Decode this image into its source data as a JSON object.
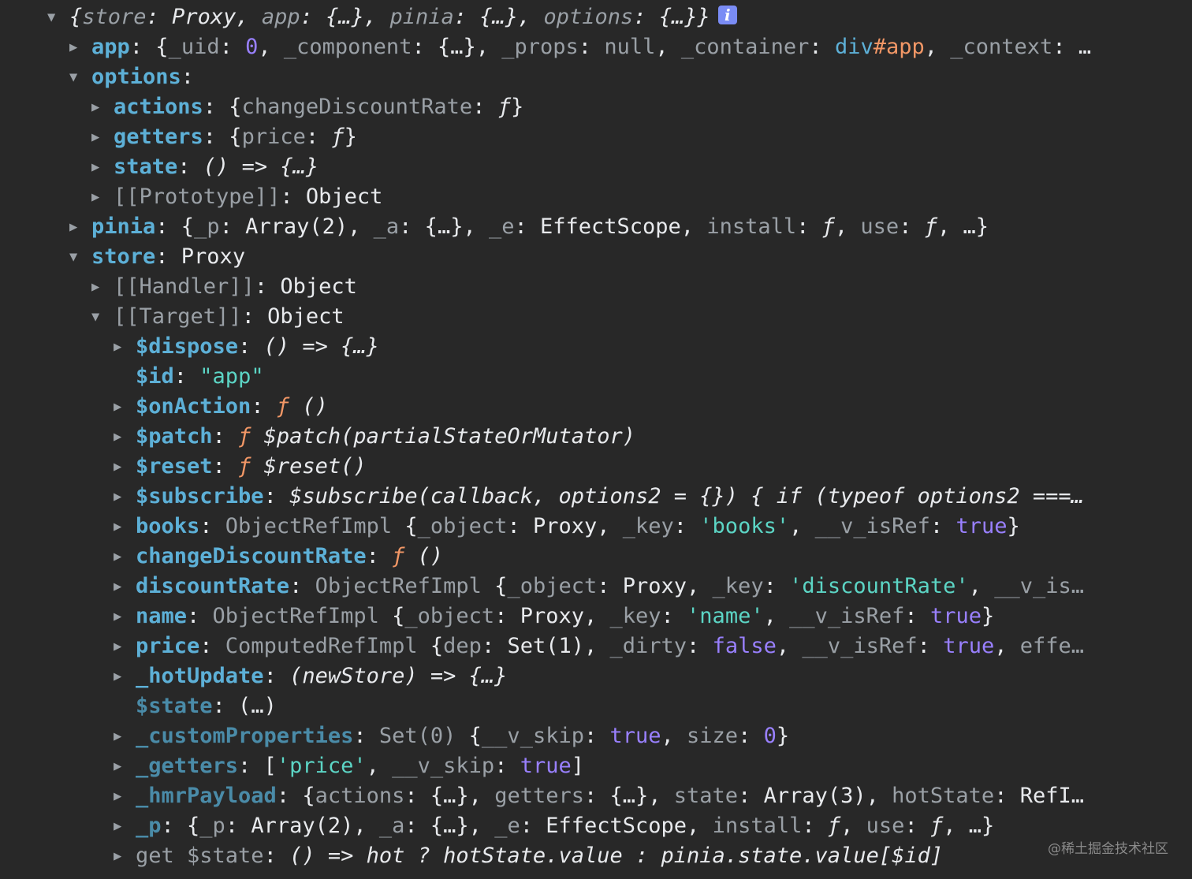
{
  "rows": [
    {
      "indent": 0,
      "toggle": "expanded",
      "segs": [
        {
          "c": "p it",
          "t": "{"
        },
        {
          "c": "gry it",
          "t": "store"
        },
        {
          "c": "p it",
          "t": ": Proxy, "
        },
        {
          "c": "gry it",
          "t": "app"
        },
        {
          "c": "p it",
          "t": ": {…}, "
        },
        {
          "c": "gry it",
          "t": "pinia"
        },
        {
          "c": "p it",
          "t": ": {…}, "
        },
        {
          "c": "gry it",
          "t": "options"
        },
        {
          "c": "p it",
          "t": ": {…}}"
        }
      ],
      "badge": "i"
    },
    {
      "indent": 1,
      "toggle": "collapsed",
      "segs": [
        {
          "c": "k-own",
          "t": "app"
        },
        {
          "c": "p",
          "t": ": {"
        },
        {
          "c": "gry",
          "t": "_uid"
        },
        {
          "c": "p",
          "t": ": "
        },
        {
          "c": "num",
          "t": "0"
        },
        {
          "c": "p",
          "t": ", "
        },
        {
          "c": "gry",
          "t": "_component"
        },
        {
          "c": "p",
          "t": ": {…}, "
        },
        {
          "c": "gry",
          "t": "_props"
        },
        {
          "c": "p",
          "t": ": "
        },
        {
          "c": "nul",
          "t": "null"
        },
        {
          "c": "p",
          "t": ", "
        },
        {
          "c": "gry",
          "t": "_container"
        },
        {
          "c": "p",
          "t": ": "
        },
        {
          "c": "cls",
          "t": "div"
        },
        {
          "c": "htag",
          "t": "#app"
        },
        {
          "c": "p",
          "t": ", "
        },
        {
          "c": "gry",
          "t": "_context"
        },
        {
          "c": "p",
          "t": ": …"
        }
      ]
    },
    {
      "indent": 1,
      "toggle": "expanded",
      "segs": [
        {
          "c": "k-own",
          "t": "options"
        },
        {
          "c": "p",
          "t": ":"
        }
      ]
    },
    {
      "indent": 2,
      "toggle": "collapsed",
      "segs": [
        {
          "c": "k-own",
          "t": "actions"
        },
        {
          "c": "p",
          "t": ": {"
        },
        {
          "c": "gry",
          "t": "changeDiscountRate"
        },
        {
          "c": "p",
          "t": ": "
        },
        {
          "c": "p it",
          "t": "ƒ"
        },
        {
          "c": "p",
          "t": "}"
        }
      ]
    },
    {
      "indent": 2,
      "toggle": "collapsed",
      "segs": [
        {
          "c": "k-own",
          "t": "getters"
        },
        {
          "c": "p",
          "t": ": {"
        },
        {
          "c": "gry",
          "t": "price"
        },
        {
          "c": "p",
          "t": ": "
        },
        {
          "c": "p it",
          "t": "ƒ"
        },
        {
          "c": "p",
          "t": "}"
        }
      ]
    },
    {
      "indent": 2,
      "toggle": "collapsed",
      "segs": [
        {
          "c": "k-own",
          "t": "state"
        },
        {
          "c": "p",
          "t": ": "
        },
        {
          "c": "p it",
          "t": "() => {…}"
        }
      ]
    },
    {
      "indent": 2,
      "toggle": "collapsed",
      "segs": [
        {
          "c": "k-int",
          "t": "[[Prototype]]"
        },
        {
          "c": "p",
          "t": ": Object"
        }
      ]
    },
    {
      "indent": 1,
      "toggle": "collapsed",
      "segs": [
        {
          "c": "k-own",
          "t": "pinia"
        },
        {
          "c": "p",
          "t": ": {"
        },
        {
          "c": "gry",
          "t": "_p"
        },
        {
          "c": "p",
          "t": ": Array(2), "
        },
        {
          "c": "gry",
          "t": "_a"
        },
        {
          "c": "p",
          "t": ": {…}, "
        },
        {
          "c": "gry",
          "t": "_e"
        },
        {
          "c": "p",
          "t": ": EffectScope, "
        },
        {
          "c": "gry",
          "t": "install"
        },
        {
          "c": "p",
          "t": ": "
        },
        {
          "c": "p it",
          "t": "ƒ"
        },
        {
          "c": "p",
          "t": ", "
        },
        {
          "c": "gry",
          "t": "use"
        },
        {
          "c": "p",
          "t": ": "
        },
        {
          "c": "p it",
          "t": "ƒ"
        },
        {
          "c": "p",
          "t": ", …}"
        }
      ]
    },
    {
      "indent": 1,
      "toggle": "expanded",
      "segs": [
        {
          "c": "k-own",
          "t": "store"
        },
        {
          "c": "p",
          "t": ": Proxy"
        }
      ]
    },
    {
      "indent": 2,
      "toggle": "collapsed",
      "segs": [
        {
          "c": "k-int",
          "t": "[[Handler]]"
        },
        {
          "c": "p",
          "t": ": Object"
        }
      ]
    },
    {
      "indent": 2,
      "toggle": "expanded",
      "segs": [
        {
          "c": "k-int",
          "t": "[[Target]]"
        },
        {
          "c": "p",
          "t": ": Object"
        }
      ]
    },
    {
      "indent": 3,
      "toggle": "collapsed",
      "segs": [
        {
          "c": "k-own",
          "t": "$dispose"
        },
        {
          "c": "p",
          "t": ": "
        },
        {
          "c": "p it",
          "t": "() => {…}"
        }
      ]
    },
    {
      "indent": 3,
      "toggle": "none",
      "segs": [
        {
          "c": "k-own",
          "t": "$id"
        },
        {
          "c": "p",
          "t": ": "
        },
        {
          "c": "str",
          "t": "\"app\""
        }
      ]
    },
    {
      "indent": 3,
      "toggle": "collapsed",
      "segs": [
        {
          "c": "k-own",
          "t": "$onAction"
        },
        {
          "c": "p",
          "t": ": "
        },
        {
          "c": "fn",
          "t": "ƒ"
        },
        {
          "c": "p it",
          "t": " ()"
        }
      ]
    },
    {
      "indent": 3,
      "toggle": "collapsed",
      "segs": [
        {
          "c": "k-own",
          "t": "$patch"
        },
        {
          "c": "p",
          "t": ": "
        },
        {
          "c": "fn",
          "t": "ƒ"
        },
        {
          "c": "p it",
          "t": " $patch(partialStateOrMutator)"
        }
      ]
    },
    {
      "indent": 3,
      "toggle": "collapsed",
      "segs": [
        {
          "c": "k-own",
          "t": "$reset"
        },
        {
          "c": "p",
          "t": ": "
        },
        {
          "c": "fn",
          "t": "ƒ"
        },
        {
          "c": "p it",
          "t": " $reset()"
        }
      ]
    },
    {
      "indent": 3,
      "toggle": "collapsed",
      "segs": [
        {
          "c": "k-own",
          "t": "$subscribe"
        },
        {
          "c": "p",
          "t": ": "
        },
        {
          "c": "p it",
          "t": "$subscribe(callback, options2 = {}) { if (typeof options2 ===…"
        }
      ]
    },
    {
      "indent": 3,
      "toggle": "collapsed",
      "segs": [
        {
          "c": "k-own",
          "t": "books"
        },
        {
          "c": "p",
          "t": ": "
        },
        {
          "c": "gry",
          "t": "ObjectRefImpl "
        },
        {
          "c": "p",
          "t": "{"
        },
        {
          "c": "gry",
          "t": "_object"
        },
        {
          "c": "p",
          "t": ": Proxy, "
        },
        {
          "c": "gry",
          "t": "_key"
        },
        {
          "c": "p",
          "t": ": "
        },
        {
          "c": "str",
          "t": "'books'"
        },
        {
          "c": "p",
          "t": ", "
        },
        {
          "c": "gry",
          "t": "__v_isRef"
        },
        {
          "c": "p",
          "t": ": "
        },
        {
          "c": "bool",
          "t": "true"
        },
        {
          "c": "p",
          "t": "}"
        }
      ]
    },
    {
      "indent": 3,
      "toggle": "collapsed",
      "segs": [
        {
          "c": "k-own",
          "t": "changeDiscountRate"
        },
        {
          "c": "p",
          "t": ": "
        },
        {
          "c": "fn",
          "t": "ƒ"
        },
        {
          "c": "p it",
          "t": " ()"
        }
      ]
    },
    {
      "indent": 3,
      "toggle": "collapsed",
      "segs": [
        {
          "c": "k-own",
          "t": "discountRate"
        },
        {
          "c": "p",
          "t": ": "
        },
        {
          "c": "gry",
          "t": "ObjectRefImpl "
        },
        {
          "c": "p",
          "t": "{"
        },
        {
          "c": "gry",
          "t": "_object"
        },
        {
          "c": "p",
          "t": ": Proxy, "
        },
        {
          "c": "gry",
          "t": "_key"
        },
        {
          "c": "p",
          "t": ": "
        },
        {
          "c": "str",
          "t": "'discountRate'"
        },
        {
          "c": "p",
          "t": ", "
        },
        {
          "c": "gry",
          "t": "__v_is…"
        }
      ]
    },
    {
      "indent": 3,
      "toggle": "collapsed",
      "segs": [
        {
          "c": "k-own",
          "t": "name"
        },
        {
          "c": "p",
          "t": ": "
        },
        {
          "c": "gry",
          "t": "ObjectRefImpl "
        },
        {
          "c": "p",
          "t": "{"
        },
        {
          "c": "gry",
          "t": "_object"
        },
        {
          "c": "p",
          "t": ": Proxy, "
        },
        {
          "c": "gry",
          "t": "_key"
        },
        {
          "c": "p",
          "t": ": "
        },
        {
          "c": "str",
          "t": "'name'"
        },
        {
          "c": "p",
          "t": ", "
        },
        {
          "c": "gry",
          "t": "__v_isRef"
        },
        {
          "c": "p",
          "t": ": "
        },
        {
          "c": "bool",
          "t": "true"
        },
        {
          "c": "p",
          "t": "}"
        }
      ]
    },
    {
      "indent": 3,
      "toggle": "collapsed",
      "segs": [
        {
          "c": "k-own",
          "t": "price"
        },
        {
          "c": "p",
          "t": ": "
        },
        {
          "c": "gry",
          "t": "ComputedRefImpl "
        },
        {
          "c": "p",
          "t": "{"
        },
        {
          "c": "gry",
          "t": "dep"
        },
        {
          "c": "p",
          "t": ": Set(1), "
        },
        {
          "c": "gry",
          "t": "_dirty"
        },
        {
          "c": "p",
          "t": ": "
        },
        {
          "c": "bool",
          "t": "false"
        },
        {
          "c": "p",
          "t": ", "
        },
        {
          "c": "gry",
          "t": "__v_isRef"
        },
        {
          "c": "p",
          "t": ": "
        },
        {
          "c": "bool",
          "t": "true"
        },
        {
          "c": "p",
          "t": ", "
        },
        {
          "c": "gry",
          "t": "effe…"
        }
      ]
    },
    {
      "indent": 3,
      "toggle": "collapsed",
      "segs": [
        {
          "c": "k-own",
          "t": "_hotUpdate"
        },
        {
          "c": "p",
          "t": ": "
        },
        {
          "c": "p it",
          "t": "(newStore) => {…}"
        }
      ]
    },
    {
      "indent": 3,
      "toggle": "none",
      "segs": [
        {
          "c": "k-own-dim",
          "t": "$state"
        },
        {
          "c": "p",
          "t": ":  (…)"
        }
      ]
    },
    {
      "indent": 3,
      "toggle": "collapsed",
      "segs": [
        {
          "c": "k-own-dim",
          "t": "_customProperties"
        },
        {
          "c": "p",
          "t": ": "
        },
        {
          "c": "gry",
          "t": "Set(0) "
        },
        {
          "c": "p",
          "t": "{"
        },
        {
          "c": "gry",
          "t": "__v_skip"
        },
        {
          "c": "p",
          "t": ": "
        },
        {
          "c": "bool",
          "t": "true"
        },
        {
          "c": "p",
          "t": ", "
        },
        {
          "c": "gry",
          "t": "size"
        },
        {
          "c": "p",
          "t": ": "
        },
        {
          "c": "num",
          "t": "0"
        },
        {
          "c": "p",
          "t": "}"
        }
      ]
    },
    {
      "indent": 3,
      "toggle": "collapsed",
      "segs": [
        {
          "c": "k-own-dim",
          "t": "_getters"
        },
        {
          "c": "p",
          "t": ": ["
        },
        {
          "c": "str",
          "t": "'price'"
        },
        {
          "c": "p",
          "t": ", "
        },
        {
          "c": "gry",
          "t": "__v_skip"
        },
        {
          "c": "p",
          "t": ": "
        },
        {
          "c": "bool",
          "t": "true"
        },
        {
          "c": "p",
          "t": "]"
        }
      ]
    },
    {
      "indent": 3,
      "toggle": "collapsed",
      "segs": [
        {
          "c": "k-own-dim",
          "t": "_hmrPayload"
        },
        {
          "c": "p",
          "t": ": {"
        },
        {
          "c": "gry",
          "t": "actions"
        },
        {
          "c": "p",
          "t": ": {…}, "
        },
        {
          "c": "gry",
          "t": "getters"
        },
        {
          "c": "p",
          "t": ": {…}, "
        },
        {
          "c": "gry",
          "t": "state"
        },
        {
          "c": "p",
          "t": ": Array(3), "
        },
        {
          "c": "gry",
          "t": "hotState"
        },
        {
          "c": "p",
          "t": ": RefI…"
        }
      ]
    },
    {
      "indent": 3,
      "toggle": "collapsed",
      "segs": [
        {
          "c": "k-own-dim",
          "t": "_p"
        },
        {
          "c": "p",
          "t": ": {"
        },
        {
          "c": "gry",
          "t": "_p"
        },
        {
          "c": "p",
          "t": ": Array(2), "
        },
        {
          "c": "gry",
          "t": "_a"
        },
        {
          "c": "p",
          "t": ": {…}, "
        },
        {
          "c": "gry",
          "t": "_e"
        },
        {
          "c": "p",
          "t": ": EffectScope, "
        },
        {
          "c": "gry",
          "t": "install"
        },
        {
          "c": "p",
          "t": ": "
        },
        {
          "c": "p it",
          "t": "ƒ"
        },
        {
          "c": "p",
          "t": ", "
        },
        {
          "c": "gry",
          "t": "use"
        },
        {
          "c": "p",
          "t": ": "
        },
        {
          "c": "p it",
          "t": "ƒ"
        },
        {
          "c": "p",
          "t": ", …}"
        }
      ]
    },
    {
      "indent": 3,
      "toggle": "collapsed",
      "segs": [
        {
          "c": "k-inh",
          "t": "get $state"
        },
        {
          "c": "p",
          "t": ": "
        },
        {
          "c": "p it",
          "t": "() => hot ? hotState.value : pinia.state.value[$id]"
        }
      ]
    }
  ],
  "watermark": "@稀土掘金技术社区"
}
